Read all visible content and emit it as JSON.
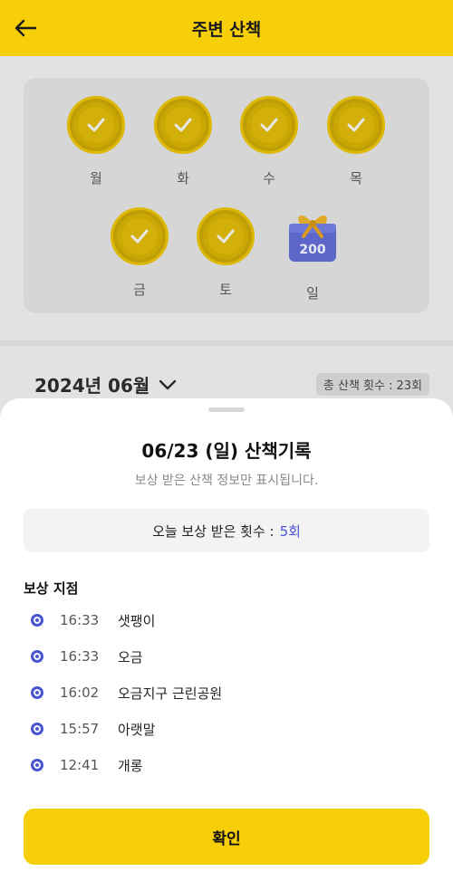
{
  "header": {
    "title": "주변 산책"
  },
  "week": {
    "days": [
      {
        "label": "월",
        "status": "checked"
      },
      {
        "label": "화",
        "status": "checked"
      },
      {
        "label": "수",
        "status": "checked"
      },
      {
        "label": "목",
        "status": "checked"
      },
      {
        "label": "금",
        "status": "checked"
      },
      {
        "label": "토",
        "status": "checked"
      },
      {
        "label": "일",
        "status": "gift",
        "gift_value": "200"
      }
    ]
  },
  "month_selector": {
    "label": "2024년 06월"
  },
  "total_walks": {
    "label": "총 산책 횟수 :",
    "value": "23회"
  },
  "sheet": {
    "title": "06/23 (일) 산책기록",
    "subtitle": "보상 받은 산책 정보만 표시됩니다.",
    "today_count": {
      "label": "오늘 보상 받은 횟수 :",
      "value": "5회"
    },
    "section_title": "보상 지점",
    "points": [
      {
        "time": "16:33",
        "place": "샛팽이"
      },
      {
        "time": "16:33",
        "place": "오금"
      },
      {
        "time": "16:02",
        "place": "오금지구 근린공원"
      },
      {
        "time": "15:57",
        "place": "아랫말"
      },
      {
        "time": "12:41",
        "place": "개롱"
      }
    ],
    "confirm_label": "확인"
  },
  "colors": {
    "accent": "#f6cf08",
    "link": "#4b55d6",
    "badge": "#c9a806"
  }
}
